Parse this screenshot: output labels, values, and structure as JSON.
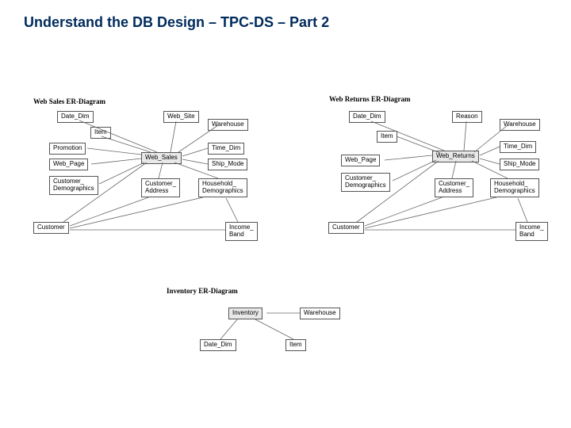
{
  "title": "Understand the DB Design – TPC-DS – Part 2",
  "diagrams": {
    "web_sales": {
      "title": "Web Sales ER-Diagram",
      "fact": "Web_Sales",
      "entities": {
        "date_dim": "Date_Dim",
        "item": "Item",
        "promotion": "Promotion",
        "web_page": "Web_Page",
        "customer_demo": "Customer_\nDemographics",
        "customer": "Customer",
        "web_site": "Web_Site",
        "warehouse": "Warehouse",
        "time_dim": "Time_Dim",
        "ship_mode": "Ship_Mode",
        "customer_addr": "Customer_\nAddress",
        "household_demo": "Household_\nDemographics",
        "income_band": "Income_\nBand"
      }
    },
    "web_returns": {
      "title": "Web Returns ER-Diagram",
      "fact": "Web_Returns",
      "entities": {
        "date_dim": "Date_Dim",
        "item": "Item",
        "web_page": "Web_Page",
        "customer_demo": "Customer_\nDemographics",
        "customer": "Customer",
        "reason": "Reason",
        "warehouse": "Warehouse",
        "time_dim": "Time_Dim",
        "ship_mode": "Ship_Mode",
        "customer_addr": "Customer_\nAddress",
        "household_demo": "Household_\nDemographics",
        "income_band": "Income_\nBand"
      }
    },
    "inventory": {
      "title": "Inventory ER-Diagram",
      "fact": "Inventory",
      "entities": {
        "warehouse": "Warehouse",
        "date_dim": "Date_Dim",
        "item": "Item"
      }
    }
  }
}
